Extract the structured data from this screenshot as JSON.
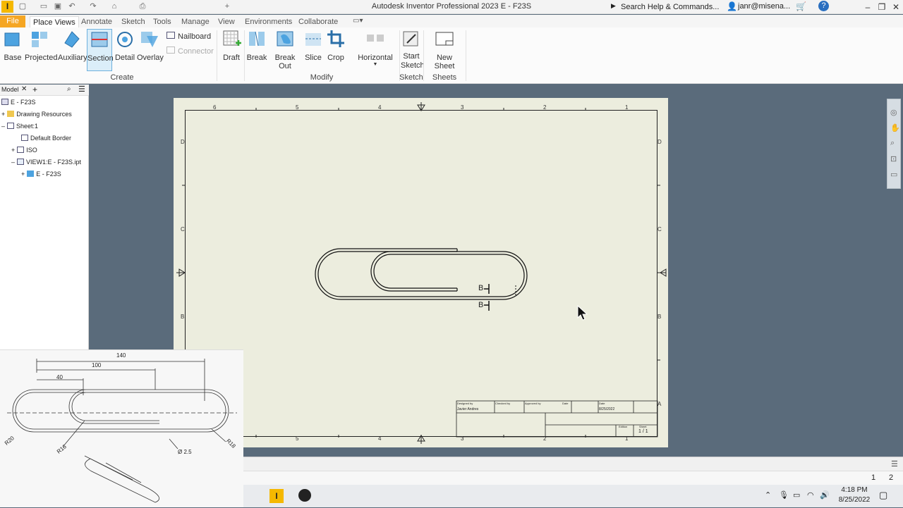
{
  "app": {
    "title": "Autodesk Inventor Professional 2023   E - F23S"
  },
  "search": {
    "placeholder": "Search Help & Commands..."
  },
  "user": {
    "name": "janr@misena..."
  },
  "tabs": [
    "File",
    "Place Views",
    "Annotate",
    "Sketch",
    "Tools",
    "Manage",
    "View",
    "Environments",
    "Collaborate"
  ],
  "ribbon": {
    "create": {
      "label": "Create",
      "buttons": [
        "Base",
        "Projected",
        "Auxiliary",
        "Section",
        "Detail",
        "Overlay"
      ],
      "nailboard": "Nailboard",
      "connector": "Connector",
      "draft": "Draft"
    },
    "modify": {
      "label": "Modify",
      "buttons": [
        "Break",
        "Break Out",
        "Slice",
        "Crop",
        "Horizontal"
      ]
    },
    "sketch": {
      "label": "Sketch",
      "start_sketch": "Start Sketch"
    },
    "sheets": {
      "label": "Sheets",
      "new_sheet": "New Sheet"
    }
  },
  "browser": {
    "tab": "Model",
    "items": [
      {
        "label": "E - F23S"
      },
      {
        "label": "Drawing Resources"
      },
      {
        "label": "Sheet:1"
      },
      {
        "label": "Default Border"
      },
      {
        "label": "ISO"
      },
      {
        "label": "VIEW1:E - F23S.ipt"
      },
      {
        "label": "E - F23S"
      }
    ]
  },
  "sheet": {
    "top_zones": [
      "6",
      "5",
      "4",
      "3",
      "2",
      "1"
    ],
    "side_zones": [
      "D",
      "C",
      "B",
      "A"
    ],
    "section_label": "B",
    "title_block": {
      "designed_by": "Designed by",
      "designer": "Javier Andres",
      "checked_by": "Checked by",
      "approved_by": "Approved by",
      "date_label": "Date",
      "date": "8/25/2022",
      "edition": "Edition",
      "sheet_label": "Sheet",
      "sheet": "1 / 1"
    }
  },
  "reference": {
    "dims": [
      "140",
      "100",
      "40",
      "R20",
      "R16",
      "Ø 2.5",
      "R18"
    ]
  },
  "status": {
    "pages": [
      "1",
      "2"
    ]
  },
  "taskbar": {
    "time": "4:18 PM",
    "date": "8/25/2022"
  },
  "colors": {
    "file_tab": "#f5a623",
    "canvas": "#5a6b7b",
    "sheet": "#ecedde",
    "section_sel": "#dbeef9"
  }
}
